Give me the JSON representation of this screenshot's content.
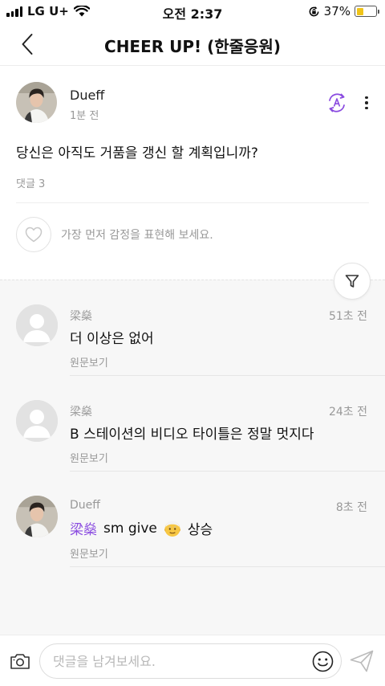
{
  "status_bar": {
    "carrier": "LG U+",
    "time": "오전 2:37",
    "battery_percent": "37%",
    "battery_level": 0.37,
    "battery_color": "#f0c419",
    "icons": [
      "signal-icon",
      "wifi-icon",
      "orientation-lock-icon",
      "battery-icon"
    ]
  },
  "header": {
    "title": "CHEER UP! (한줄응원)",
    "back_icon": "chevron-left-icon"
  },
  "post": {
    "author": "Dueff",
    "time": "1분 전",
    "body": "당신은 아직도 거품을 갱신 할 계획입니까?",
    "comment_count": "댓글 3",
    "reaction_prompt": "가장 먼저 감정을 표현해 보세요.",
    "translate_icon": "translate-icon",
    "more_icon": "more-vertical-icon",
    "accent_color": "#8a4be0"
  },
  "comments": [
    {
      "author": "梁燊",
      "time": "51초 전",
      "mention": "",
      "text": "더 이상은 없어",
      "text_after_emoji": "",
      "emoji": "",
      "original_label": "원문보기",
      "avatar": "default"
    },
    {
      "author": "梁燊",
      "time": "24초 전",
      "mention": "",
      "text": "B 스테이션의 비디오 타이틀은 정말 멋지다",
      "text_after_emoji": "",
      "emoji": "",
      "original_label": "원문보기",
      "avatar": "default"
    },
    {
      "author": "Dueff",
      "time": "8초 전",
      "mention": "梁燊",
      "text": "sm give",
      "text_after_emoji": "상승",
      "emoji": "older-man-face",
      "original_label": "원문보기",
      "avatar": "photo"
    }
  ],
  "input_bar": {
    "placeholder": "댓글을 남겨보세요.",
    "value": "",
    "camera_icon": "camera-icon",
    "emoji_icon": "smiley-icon",
    "send_icon": "send-icon"
  },
  "filter_icon": "filter-icon"
}
